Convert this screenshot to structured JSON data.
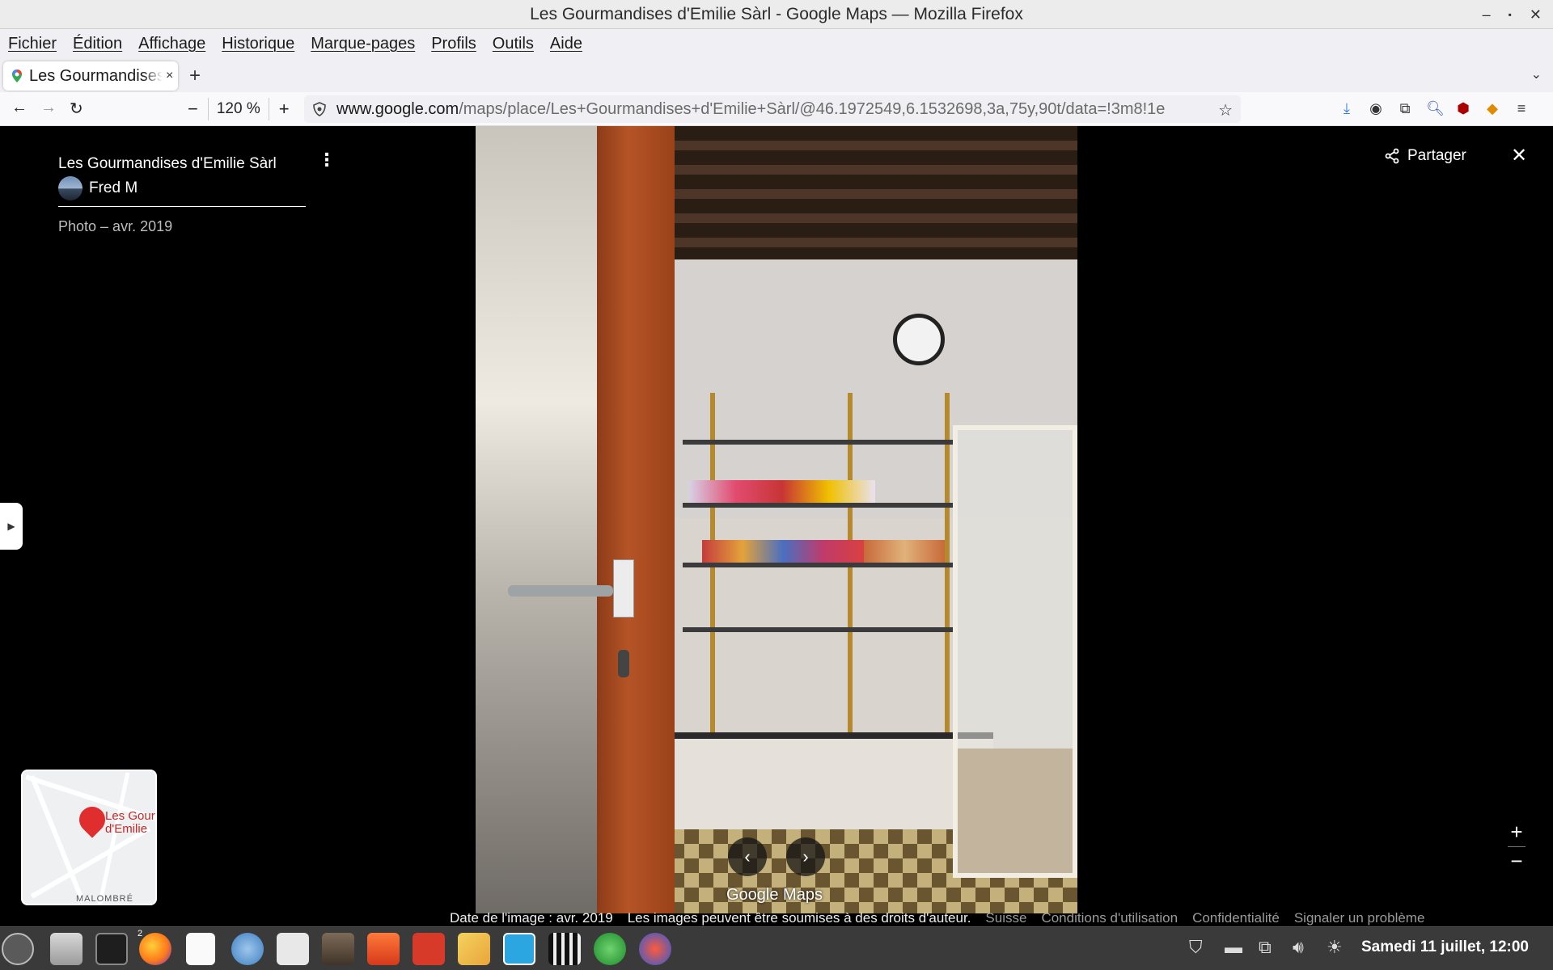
{
  "window": {
    "title": "Les Gourmandises d'Emilie Sàrl - Google Maps — Mozilla Firefox",
    "controls": [
      "–",
      "▪",
      "✕"
    ]
  },
  "menu": [
    "Fichier",
    "Édition",
    "Affichage",
    "Historique",
    "Marque-pages",
    "Profils",
    "Outils",
    "Aide"
  ],
  "tab": {
    "label": "Les Gourmandises d'Emilie Sàrl - Google Maps",
    "close": "×",
    "new": "+"
  },
  "nav": {
    "zoom_out": "−",
    "zoom_value": "120 %",
    "zoom_in": "+",
    "url_host": "www.google.com",
    "url_path": "/maps/place/Les+Gourmandises+d'Emilie+Sàrl/@46.1972549,6.1532698,3a,75y,90t/data=!3m8!1e"
  },
  "panel": {
    "title": "Les Gourmandises d'Emilie Sàrl",
    "author": "Fred M",
    "photo_date": "Photo – avr. 2019",
    "share_label": "Partager"
  },
  "minimap": {
    "pin_label_1": "Les Gour",
    "pin_label_2": "d'Emilie",
    "bottom_label": "MALOMBRÉ"
  },
  "viewer": {
    "logo": "Google Maps",
    "zoom_in": "+",
    "zoom_out": "−"
  },
  "footer": {
    "image_date": "Date de l'image : avr. 2019",
    "copyright": "Les images peuvent être soumises à des droits d'auteur.",
    "links": [
      "Suisse",
      "Conditions d'utilisation",
      "Confidentialité",
      "Signaler un problème"
    ]
  },
  "taskbar": {
    "badge": "2",
    "clock": "Samedi 11 juillet, 12:00"
  }
}
